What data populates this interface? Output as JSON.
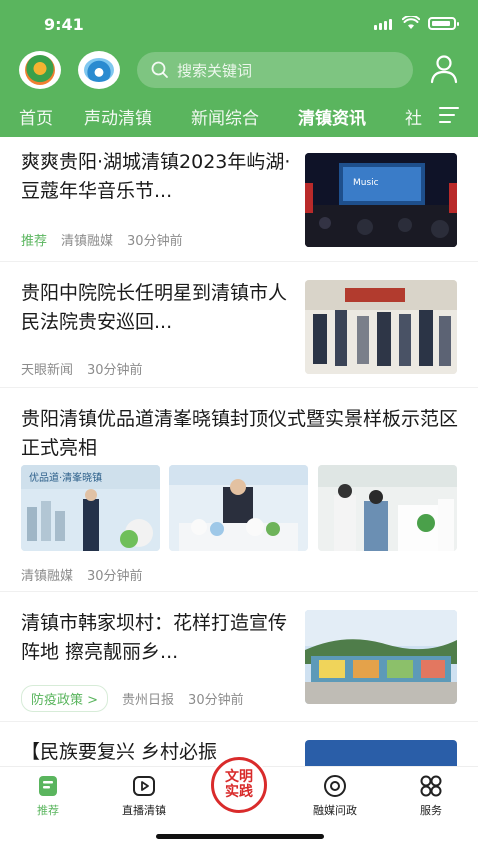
{
  "status_bar": {
    "time": "9:41"
  },
  "header": {
    "search_placeholder": "搜索关键词",
    "tabs": [
      "首页",
      "声动清镇",
      "新闻综合",
      "清镇资讯",
      "社"
    ],
    "active_tab": "清镇资讯",
    "theme_color": "#5ab55e"
  },
  "feed": [
    {
      "title": "爽爽贵阳·湖城清镇2023年屿湖·豆蔻年华音乐节...",
      "badge": "推荐",
      "source": "清镇融媒",
      "time": "30分钟前"
    },
    {
      "title": "贵阳中院院长任明星到清镇市人民法院贵安巡回...",
      "source": "天眼新闻",
      "time": "30分钟前"
    },
    {
      "title": "贵阳清镇优品道清峯晓镇封顶仪式暨实景样板示范区正式亮相",
      "source": "清镇融媒",
      "time": "30分钟前"
    },
    {
      "title": "清镇市韩家坝村：花样打造宣传阵地 擦亮靓丽乡...",
      "tag": "防疫政策 >",
      "source": "贵州日报",
      "time": "30分钟前"
    },
    {
      "title": "【民族要复兴 乡村必振"
    }
  ],
  "bottom_nav": {
    "items": [
      "推荐",
      "直播清镇",
      "融媒问政",
      "服务"
    ],
    "center_badge": [
      "文明",
      "实践"
    ],
    "active": "推荐"
  }
}
